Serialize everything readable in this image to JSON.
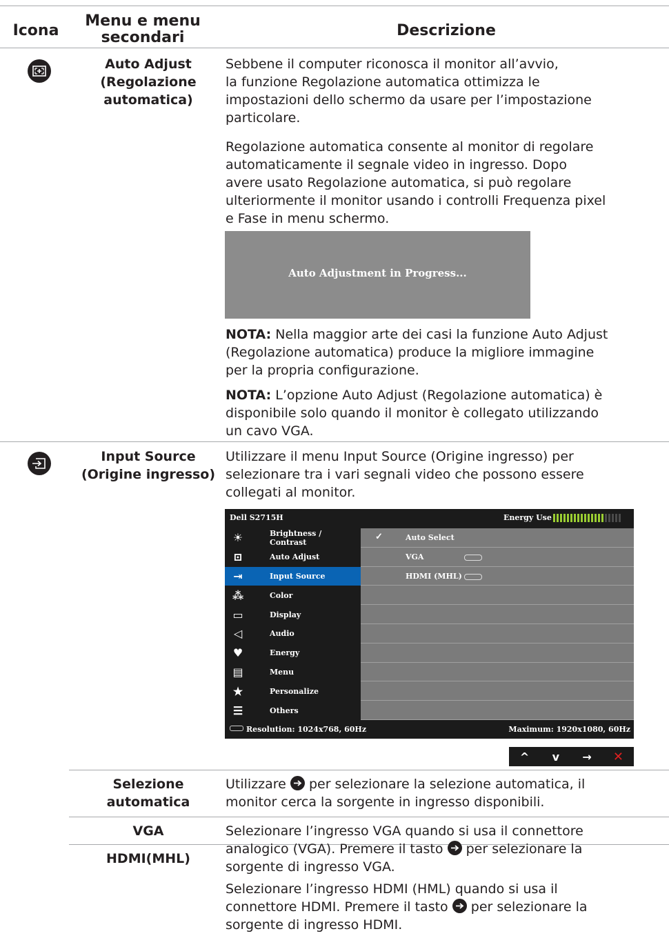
{
  "header": {
    "col_icon": "Icona",
    "col_menu_line1": "Menu e menu",
    "col_menu_line2": "secondari",
    "col_desc": "Descrizione"
  },
  "auto_adjust": {
    "name_line1": "Auto Adjust",
    "name_line2": "(Regolazione",
    "name_line3": "automatica)",
    "icon": "auto-adjust-icon",
    "para1": [
      "Sebbene il computer riconosca il monitor all’avvio,",
      "la funzione Regolazione automatica ottimizza le",
      "impostazioni dello schermo da usare per l’impostazione",
      "particolare."
    ],
    "para2": [
      "Regolazione automatica consente al monitor di regolare",
      "automaticamente il segnale video in ingresso. Dopo",
      "avere usato Regolazione automatica, si può regolare",
      "ulteriormente il monitor usando i controlli Frequenza pixel",
      "e Fase in menu schermo."
    ],
    "progress_box_text": "Auto Adjustment in Progress...",
    "note1_label": "NOTA:",
    "note1": [
      " Nella maggior arte dei casi la funzione Auto Adjust",
      "(Regolazione automatica) produce la migliore immagine",
      "per la propria configurazione."
    ],
    "note2_label": "NOTA:",
    "note2": [
      " L’opzione Auto Adjust (Regolazione automatica) è",
      "disponibile solo quando il monitor è collegato utilizzando",
      "un cavo VGA."
    ]
  },
  "input_source": {
    "name_line1": "Input Source",
    "name_line2": "(Origine ingresso)",
    "icon": "input-source-icon",
    "para": [
      "Utilizzare il menu Input Source (Origine ingresso) per",
      "selezionare tra i vari segnali video che possono essere",
      "collegati al monitor."
    ]
  },
  "osd": {
    "model": "Dell S2715H",
    "energy_label": "Energy Use",
    "energy_level": 0.75,
    "menu": [
      {
        "label": "Brightness / Contrast",
        "icon": "brightness-icon"
      },
      {
        "label": "Auto Adjust",
        "icon": "auto-adjust-icon"
      },
      {
        "label": "Input Source",
        "icon": "input-source-icon",
        "selected": true
      },
      {
        "label": "Color",
        "icon": "color-dots-icon"
      },
      {
        "label": "Display",
        "icon": "display-rect-icon"
      },
      {
        "label": "Audio",
        "icon": "speaker-icon"
      },
      {
        "label": "Energy",
        "icon": "energy-leaf-icon"
      },
      {
        "label": "Menu",
        "icon": "menu-doc-icon"
      },
      {
        "label": "Personalize",
        "icon": "star-icon"
      },
      {
        "label": "Others",
        "icon": "sliders-icon"
      }
    ],
    "options": [
      {
        "label": "Auto Select",
        "checked": true
      },
      {
        "label": "VGA",
        "connector": "vga-connector-icon"
      },
      {
        "label": "HDMI (MHL)",
        "connector": "hdmi-connector-icon"
      }
    ],
    "resolution": "Resolution: 1024x768, 60Hz",
    "maximum": "Maximum: 1920x1080, 60Hz",
    "nav": [
      "^",
      "v",
      "→",
      "✕"
    ]
  },
  "sub": [
    {
      "name_line1": "Selezione",
      "name_line2": "automatica",
      "text_a": "Utilizzare ",
      "text_b": " per selezionare la selezione automatica, il",
      "text_c": "monitor cerca la sorgente in ingresso disponibili."
    },
    {
      "name": "VGA",
      "line1": "Selezionare l’ingresso VGA quando si usa il connettore",
      "line2a": "analogico (VGA). Premere il tasto ",
      "line2b": " per selezionare la",
      "line3": "sorgente di ingresso VGA."
    },
    {
      "name": "HDMI(MHL)",
      "line1": "Selezionare l’ingresso HDMI (HML) quando si usa il",
      "line2a": "connettore HDMI. Premere il tasto ",
      "line2b": " per selezionare la",
      "line3": "sorgente di ingresso HDMI."
    }
  ]
}
